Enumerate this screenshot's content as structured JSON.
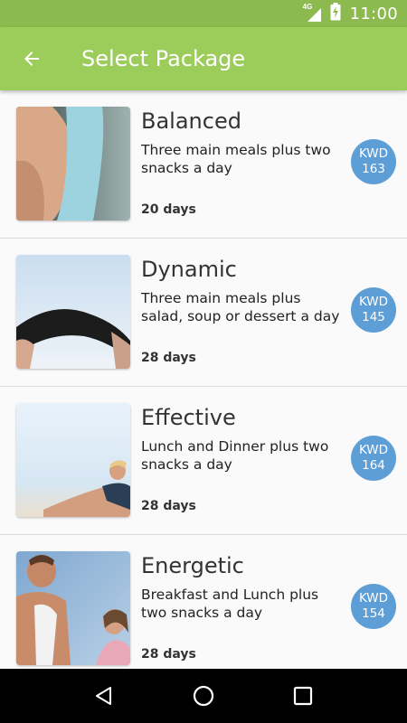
{
  "status_bar": {
    "network": "4G",
    "time": "11:00"
  },
  "app_bar": {
    "title": "Select Package",
    "back_icon": "arrow-back-icon"
  },
  "packages": [
    {
      "name": "Balanced",
      "description": "Three main meals plus two snacks a day",
      "duration": "20 days",
      "currency": "KWD",
      "price": "163",
      "image": "shoulder-photo"
    },
    {
      "name": "Dynamic",
      "description": "Three main meals plus salad, soup or dessert a day",
      "duration": "28 days",
      "currency": "KWD",
      "price": "145",
      "image": "backbend-photo"
    },
    {
      "name": "Effective",
      "description": "Lunch and Dinner plus two snacks a day",
      "duration": "28 days",
      "currency": "KWD",
      "price": "164",
      "image": "stretching-woman-photo"
    },
    {
      "name": "Energetic",
      "description": "Breakfast and Lunch plus two snacks a day",
      "duration": "28 days",
      "currency": "KWD",
      "price": "154",
      "image": "couple-workout-photo"
    }
  ],
  "nav_bar": {
    "back": "nav-back-icon",
    "home": "nav-home-icon",
    "recents": "nav-recents-icon"
  },
  "colors": {
    "status_bar": "#8cba4e",
    "app_bar": "#9ccc5a",
    "price_badge": "#5e9ed6"
  }
}
